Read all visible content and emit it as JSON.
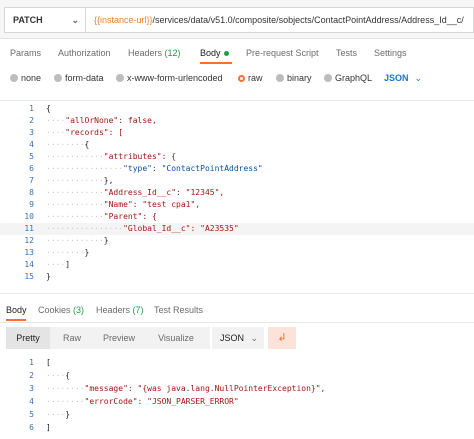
{
  "request": {
    "method": "PATCH",
    "url_variable": "{{instance-url}}",
    "url_path": "/services/data/v51.0/composite/sobjects/ContactPointAddress/Address_Id__c/"
  },
  "request_tabs": [
    {
      "label": "Params",
      "count": ""
    },
    {
      "label": "Authorization",
      "count": ""
    },
    {
      "label": "Headers",
      "count": "(12)"
    },
    {
      "label": "Body",
      "count": ""
    },
    {
      "label": "Pre-request Script",
      "count": ""
    },
    {
      "label": "Tests",
      "count": ""
    },
    {
      "label": "Settings",
      "count": ""
    }
  ],
  "body_types": [
    "none",
    "form-data",
    "x-www-form-urlencoded",
    "raw",
    "binary",
    "GraphQL"
  ],
  "selected_body_type": "raw",
  "body_format": "JSON",
  "request_body_lines": [
    "{",
    "\"allOrNone\": false,",
    "\"records\": [",
    "{",
    "\"attributes\": {",
    "\"type\": \"ContactPointAddress\"",
    "},",
    "\"Address_Id__c\": \"12345\",",
    "\"Name\": \"test cpa1\",",
    "\"Parent\": {",
    "\"Global_Id__c\": \"A23535\"",
    "}",
    "}",
    "]",
    "}"
  ],
  "response_tabs": [
    {
      "label": "Body",
      "count": ""
    },
    {
      "label": "Cookies",
      "count": "(3)"
    },
    {
      "label": "Headers",
      "count": "(7)"
    },
    {
      "label": "Test Results",
      "count": ""
    }
  ],
  "view_modes": [
    "Pretty",
    "Raw",
    "Preview",
    "Visualize"
  ],
  "response_format": "JSON",
  "response_body_lines": [
    "[",
    "{",
    "\"message\": \"{was java.lang.NullPointerException}\",",
    "\"errorCode\": \"JSON_PARSER_ERROR\"",
    "}",
    "]"
  ],
  "colors": {
    "accent": "#ff6c37",
    "green": "#1c9b4e",
    "blue": "#1f6fe0",
    "json_key": "#a31515",
    "json_string": "#0451a5",
    "json_keyword": "#0000ff"
  },
  "icons": {
    "method_dropdown": "chevron-down-icon",
    "format_dropdown": "chevron-down-icon",
    "wrap": "wrap-lines-icon"
  }
}
